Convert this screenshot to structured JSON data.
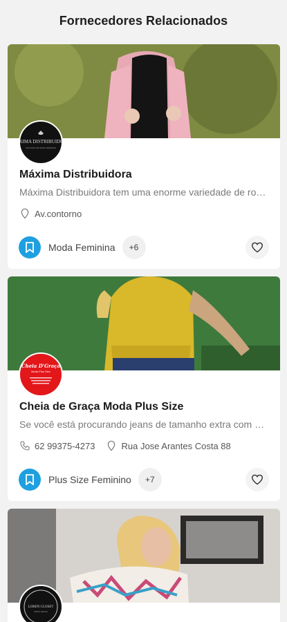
{
  "header": {
    "title": "Fornecedores Relacionados"
  },
  "suppliers": [
    {
      "name": "Máxima Distribuidora",
      "description": "Máxima Distribuidora tem uma enorme variedade de roupas",
      "address": "Av.contorno",
      "phone": "",
      "category": "Moda Feminina",
      "extra_count": "+6",
      "logo_text": "MÁXIMA DISTRIBUIDORA",
      "logo_subtext": "ATACADO DE MODA FEMININA"
    },
    {
      "name": "Cheia de Graça Moda Plus Size",
      "description": "Se você está procurando jeans de tamanho extra com qualidade",
      "address": "Rua Jose Arantes Costa 88",
      "phone": "62 99375-4273",
      "category": "Plus Size Feminino",
      "extra_count": "+7",
      "logo_text": "Cheia D'Graça",
      "logo_subtext": "Moda Plus Size"
    },
    {
      "logo_text": "LOREN CLOSET",
      "logo_subtext": "MODA JEANS"
    }
  ],
  "icons": {
    "bookmark": "bookmark-icon",
    "heart": "heart-icon",
    "location": "location-pin-icon",
    "phone": "phone-icon"
  },
  "colors": {
    "accent": "#1ea0e0",
    "logo_red": "#e3161a"
  }
}
